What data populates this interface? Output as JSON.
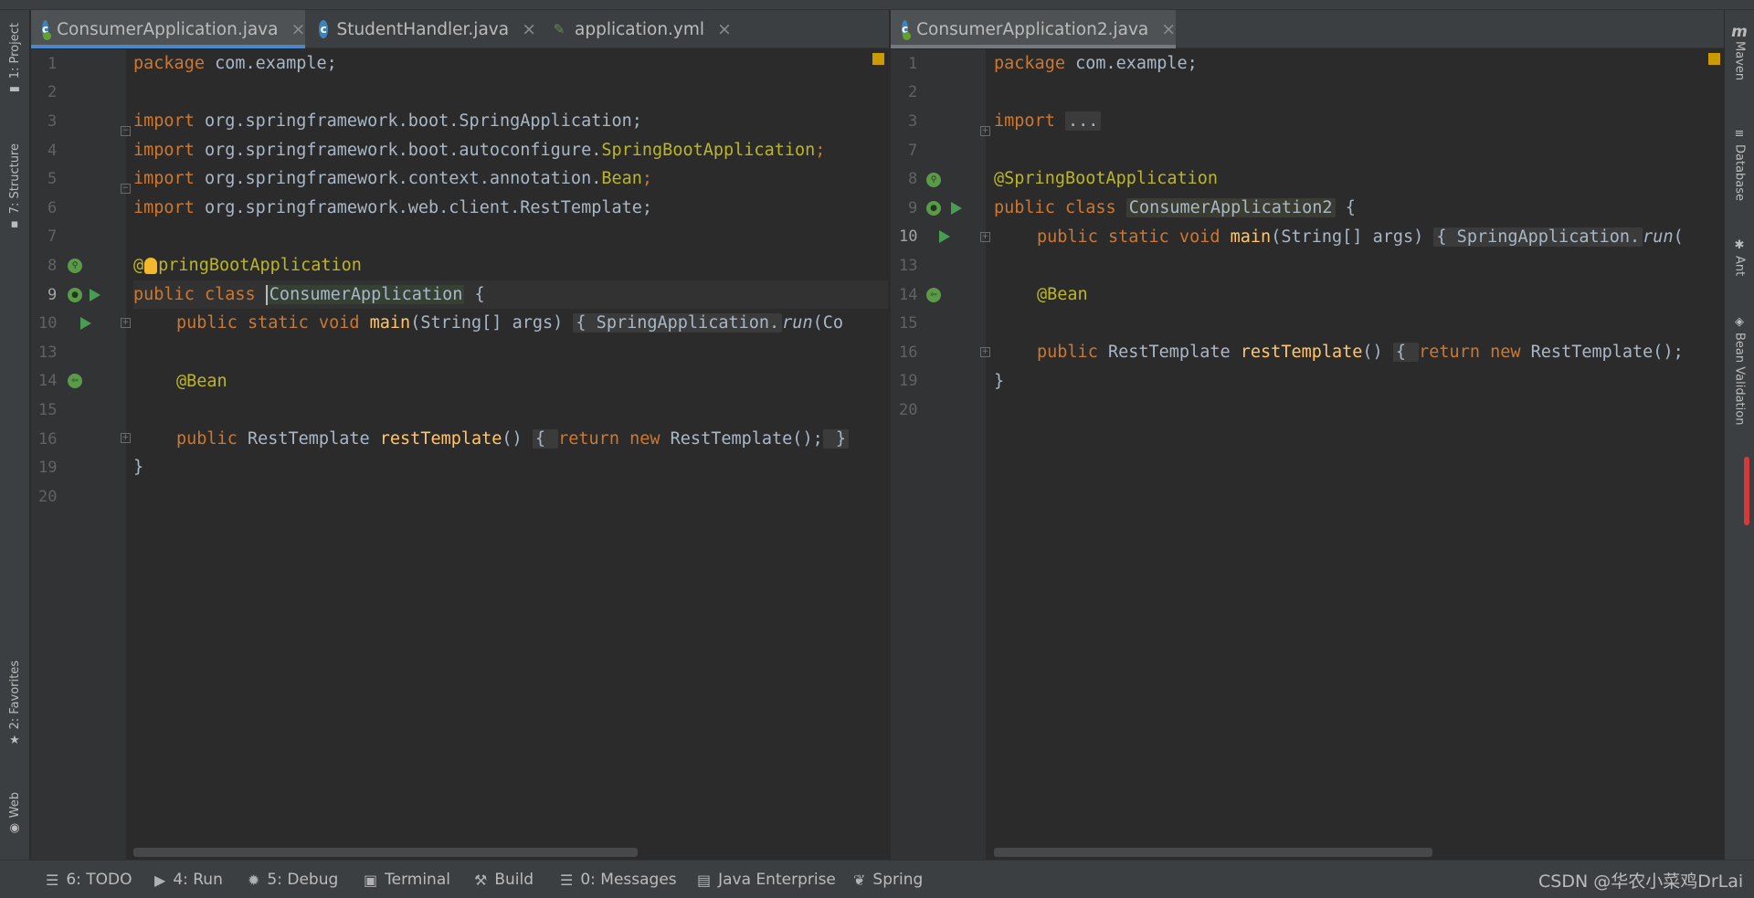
{
  "sidebar_left": {
    "project": "1: Project",
    "structure": "7: Structure",
    "favorites": "2: Favorites",
    "web": "Web"
  },
  "sidebar_right": {
    "maven_mark": "m",
    "maven": "Maven",
    "database": "Database",
    "ant": "Ant",
    "bean_validation": "Bean Validation"
  },
  "left_pane": {
    "tabs": [
      {
        "label": "ConsumerApplication.java",
        "icon": "class-icon",
        "active": true
      },
      {
        "label": "StudentHandler.java",
        "icon": "class-icon",
        "active": false
      },
      {
        "label": "application.yml",
        "icon": "yaml-icon",
        "active": false
      }
    ],
    "line_numbers": [
      "1",
      "2",
      "3",
      "4",
      "5",
      "6",
      "7",
      "8",
      "9",
      "10",
      "13",
      "14",
      "15",
      "16",
      "19",
      "20"
    ],
    "code": {
      "l1_kw": "package",
      "l1_rest": " com.example;",
      "l3_kw": "import",
      "l3_rest": " org.springframework.boot.SpringApplication;",
      "l4_kw": "import",
      "l4_rest": " org.springframework.boot.autoconfigure.",
      "l4_ann": "SpringBootApplication",
      "l4_end": ";",
      "l5_kw": "import",
      "l5_rest": " org.springframework.context.annotation.",
      "l5_ann": "Bean",
      "l5_end": ";",
      "l6_kw": "import",
      "l6_rest": " org.springframework.web.client.RestTemplate;",
      "l8_a": "@",
      "l8_b": "pringBootApplication",
      "l9_kw": "public class ",
      "l9_name": "ConsumerApplication",
      "l9_end": " {",
      "l10_kw": "public static void ",
      "l10_fn": "main",
      "l10_args": "(String[] args) ",
      "l10_body": "{ SpringApplication.",
      "l10_run": "run",
      "l10_end": "(Co",
      "l14_ann": "@Bean",
      "l16_kw": "public ",
      "l16_type": "RestTemplate ",
      "l16_fn": "restTemplate",
      "l16_paren": "() ",
      "l16_b1": "{ ",
      "l16_ret": "return new ",
      "l16_new": "RestTemplate();",
      "l16_b2": " }",
      "l19": "}"
    }
  },
  "right_pane": {
    "tabs": [
      {
        "label": "ConsumerApplication2.java",
        "icon": "class-icon",
        "active": true
      }
    ],
    "line_numbers": [
      "1",
      "2",
      "3",
      "7",
      "8",
      "9",
      "10",
      "13",
      "14",
      "15",
      "16",
      "19",
      "20"
    ],
    "code": {
      "l1_kw": "package",
      "l1_rest": " com.example;",
      "l3_kw": "import",
      "l3_fold": "...",
      "l8_ann": "@SpringBootApplication",
      "l9_kw": "public class ",
      "l9_name": "ConsumerApplication2",
      "l9_end": " {",
      "l10_kw": "public static void ",
      "l10_fn": "main",
      "l10_args": "(String[] args) ",
      "l10_body": "{ SpringApplication.",
      "l10_run": "run",
      "l10_end": "(",
      "l14_ann": "@Bean",
      "l16_kw": "public ",
      "l16_type": "RestTemplate ",
      "l16_fn": "restTemplate",
      "l16_paren": "() ",
      "l16_b1": "{ ",
      "l16_ret": "return new ",
      "l16_new": "RestTemplate();",
      "l19": "}"
    }
  },
  "bottom_bar": {
    "todo": "6: TODO",
    "run": "4: Run",
    "debug": "5: Debug",
    "terminal": "Terminal",
    "build": "Build",
    "messages": "0: Messages",
    "java_enterprise": "Java Enterprise",
    "spring": "Spring",
    "watermark": "CSDN @华农小菜鸡DrLai"
  },
  "colors": {
    "keyword": "#cc7832",
    "annotation": "#bbb529",
    "method": "#ffc66d",
    "text": "#a9b7c6",
    "accent": "#4a88c7"
  }
}
